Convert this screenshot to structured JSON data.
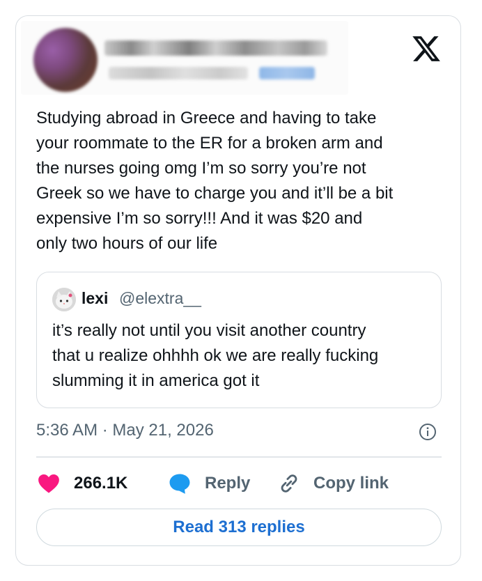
{
  "tweet": {
    "text": "Studying abroad in Greece and having to take\nyour roommate to the ER for a broken arm and\nthe nurses going omg I’m so sorry you’re not\nGreek so we have to charge you and it’ll be a bit\nexpensive I’m so sorry!!! And it was $20 and\nonly two hours of our life",
    "timestamp": "5:36 AM · May 21, 2026"
  },
  "quote": {
    "name": "lexi",
    "handle": "@elextra__",
    "text": "it’s really not until you visit another country\nthat u realize ohhhh ok we are really fucking\nslumming it in america got it"
  },
  "actions": {
    "likes": "266.1K",
    "reply_label": "Reply",
    "copy_label": "Copy link"
  },
  "read_replies_label": "Read 313 replies",
  "icons": {
    "logo": "x-logo-icon",
    "info": "info-icon",
    "like": "heart-icon",
    "reply": "speech-bubble-icon",
    "copy": "link-icon"
  },
  "colors": {
    "heart": "#f91880",
    "reply": "#1d9bf0",
    "link_blue": "#1d6fd1",
    "secondary_text": "#536471"
  }
}
